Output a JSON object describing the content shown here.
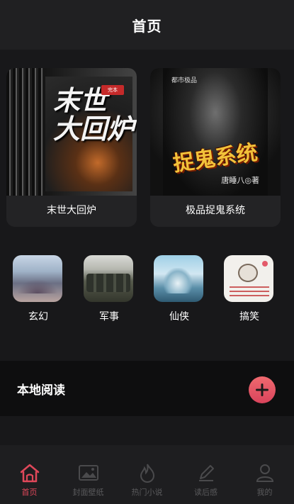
{
  "header": {
    "title": "首页"
  },
  "books": [
    {
      "name": "末世大回炉",
      "cover_title": "末世\n大回炉",
      "cover_badge": "完本"
    },
    {
      "name": "极品捉鬼系统",
      "cover_top": "都市极品",
      "cover_title": "捉鬼系统",
      "cover_author": "唐睡八◎著"
    }
  ],
  "categories": [
    {
      "label": "玄幻"
    },
    {
      "label": "军事"
    },
    {
      "label": "仙侠"
    },
    {
      "label": "搞笑"
    }
  ],
  "local_reading": {
    "label": "本地阅读",
    "add_icon": "plus-icon"
  },
  "tabbar": {
    "items": [
      {
        "label": "首页",
        "icon": "home-icon",
        "active": true
      },
      {
        "label": "封面壁纸",
        "icon": "image-icon",
        "active": false
      },
      {
        "label": "热门小说",
        "icon": "flame-icon",
        "active": false
      },
      {
        "label": "读后感",
        "icon": "pen-icon",
        "active": false
      },
      {
        "label": "我的",
        "icon": "user-icon",
        "active": false
      }
    ]
  },
  "colors": {
    "accent": "#e0485a",
    "background": "#18181a",
    "inactive": "#5a5a5c"
  }
}
